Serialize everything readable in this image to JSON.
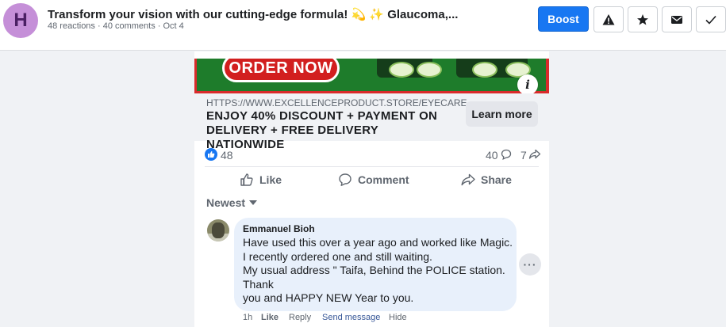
{
  "header": {
    "avatar_letter": "H",
    "title": "Transform your vision with our cutting-edge formula! 💫 ✨ Glaucoma,...",
    "subtitle": "48 reactions · 40 comments · Oct 4",
    "boost_label": "Boost",
    "icons": [
      "warning-icon",
      "star-icon",
      "envelope-icon",
      "checkmark-icon"
    ]
  },
  "ad": {
    "order_now": "ORDER NOW",
    "url": "HTTPS://WWW.EXCELLENCEPRODUCT.STORE/EYECARE_...",
    "headline": "ENJOY 40% DISCOUNT + PAYMENT ON DELIVERY + FREE DELIVERY NATIONWIDE",
    "cta": "Learn more",
    "info_icon": "i"
  },
  "stats": {
    "reactions": "48",
    "comments": "40",
    "shares": "7"
  },
  "actions": {
    "like": "Like",
    "comment": "Comment",
    "share": "Share"
  },
  "sort": {
    "label": "Newest"
  },
  "comment": {
    "author": "Emmanuel Bioh",
    "lines": [
      "Have used this over a year ago and worked like Magic.",
      "I recently ordered one and still waiting.",
      "My usual address \" Taifa, Behind the POLICE station.",
      "Thank",
      "you and HAPPY NEW Year to you."
    ],
    "more": "···",
    "time": "1h",
    "like": "Like",
    "reply": "Reply",
    "send_message": "Send message",
    "hide": "Hide"
  },
  "colors": {
    "accent": "#1877f2",
    "avatar_bg": "#c58fd8",
    "bubble_bg": "#e8f0fb",
    "ad_green": "#1e7c2b",
    "ad_red": "#d21f1f"
  }
}
